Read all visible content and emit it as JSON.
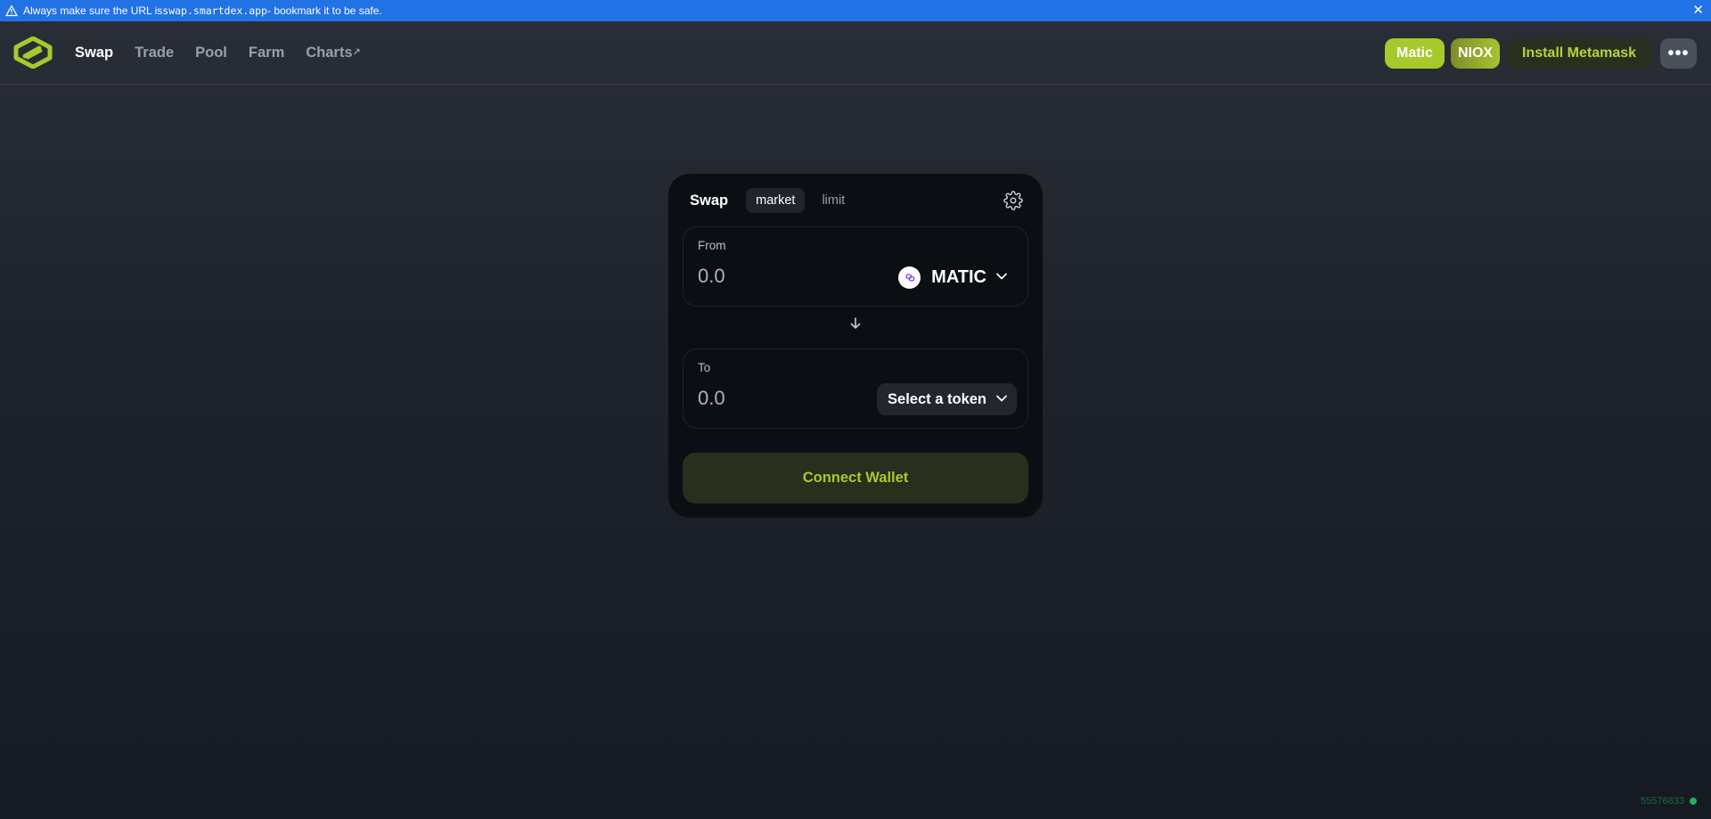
{
  "banner": {
    "text_before": "Always make sure the URL is ",
    "url": "swap.smartdex.app",
    "text_after": " - bookmark it to be safe.",
    "close": "✕"
  },
  "nav": {
    "swap": "Swap",
    "trade": "Trade",
    "pool": "Pool",
    "farm": "Farm",
    "charts": "Charts",
    "charts_ext": "↗"
  },
  "header_buttons": {
    "matic": "Matic",
    "niox": "NIOX",
    "install": "Install Metamask",
    "more": "•••"
  },
  "swap": {
    "title": "Swap",
    "tabs": {
      "market": "market",
      "limit": "limit"
    },
    "from": {
      "label": "From",
      "placeholder": "0.0",
      "token": "MATIC"
    },
    "to": {
      "label": "To",
      "placeholder": "0.0",
      "token": "Select a token"
    },
    "connect": "Connect Wallet"
  },
  "footer": {
    "block": "55576833"
  },
  "colors": {
    "accent": "#a8c92c",
    "banner": "#2172e5",
    "card": "#0b0e13"
  }
}
